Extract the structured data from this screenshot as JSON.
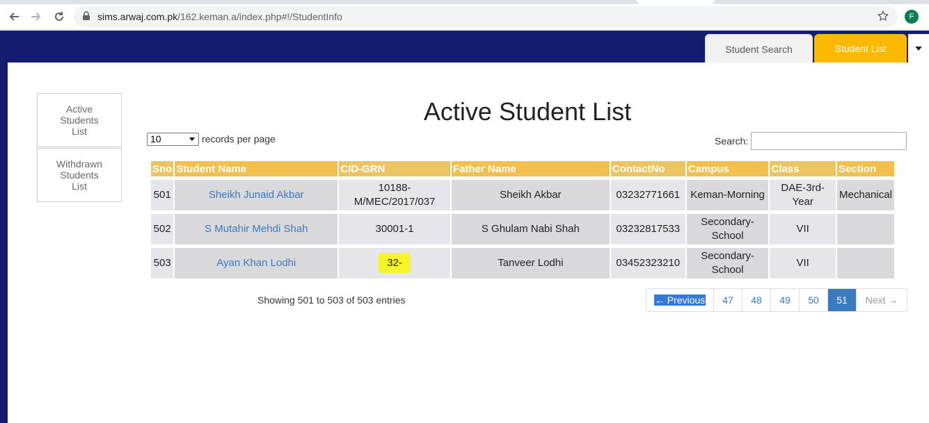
{
  "browser": {
    "url_host": "sims.arwaj.com.pk",
    "url_path": "/162.keman.a/index.php#!/StudentInfo",
    "profile_initial": "F"
  },
  "topnav": {
    "student_search": "Student Search",
    "student_list": "Student List"
  },
  "sidebar": {
    "items": [
      {
        "label": "Active Students List"
      },
      {
        "label": "Withdrawn Students List"
      }
    ]
  },
  "page": {
    "title": "Active Student List",
    "length_value": "10",
    "length_label": "records per page",
    "search_label": "Search:",
    "info": "Showing 501 to 503 of 503 entries"
  },
  "table": {
    "columns": [
      "Sno",
      "Student Name",
      "CID-GRN",
      "Father Name",
      "ContactNo",
      "Campus",
      "Class",
      "Section"
    ],
    "rows": [
      {
        "sno": "501",
        "name": "Sheikh Junaid Akbar",
        "cid": "10188-M/MEC/2017/037",
        "father": "Sheikh Akbar",
        "contact": "03232771661",
        "campus": "Keman-Morning",
        "class": "DAE-3rd-Year",
        "section": "Mechanical"
      },
      {
        "sno": "502",
        "name": "S Mutahir Mehdi Shah",
        "cid": "30001-1",
        "father": "S Ghulam Nabi Shah",
        "contact": "03232817533",
        "campus": "Secondary-School",
        "class": "VII",
        "section": ""
      },
      {
        "sno": "503",
        "name": "Ayan Khan Lodhi",
        "cid": "32-",
        "father": "Tanveer Lodhi",
        "contact": "03452323210",
        "campus": "Secondary-School",
        "class": "VII",
        "section": ""
      }
    ]
  },
  "pagination": {
    "previous": "← Previous",
    "pages": [
      "47",
      "48",
      "49",
      "50",
      "51"
    ],
    "active_page": "51",
    "next": "Next →"
  },
  "colors": {
    "header_bg": "#131c6e",
    "accent_tab": "#fbb900",
    "link": "#3a7abf"
  }
}
